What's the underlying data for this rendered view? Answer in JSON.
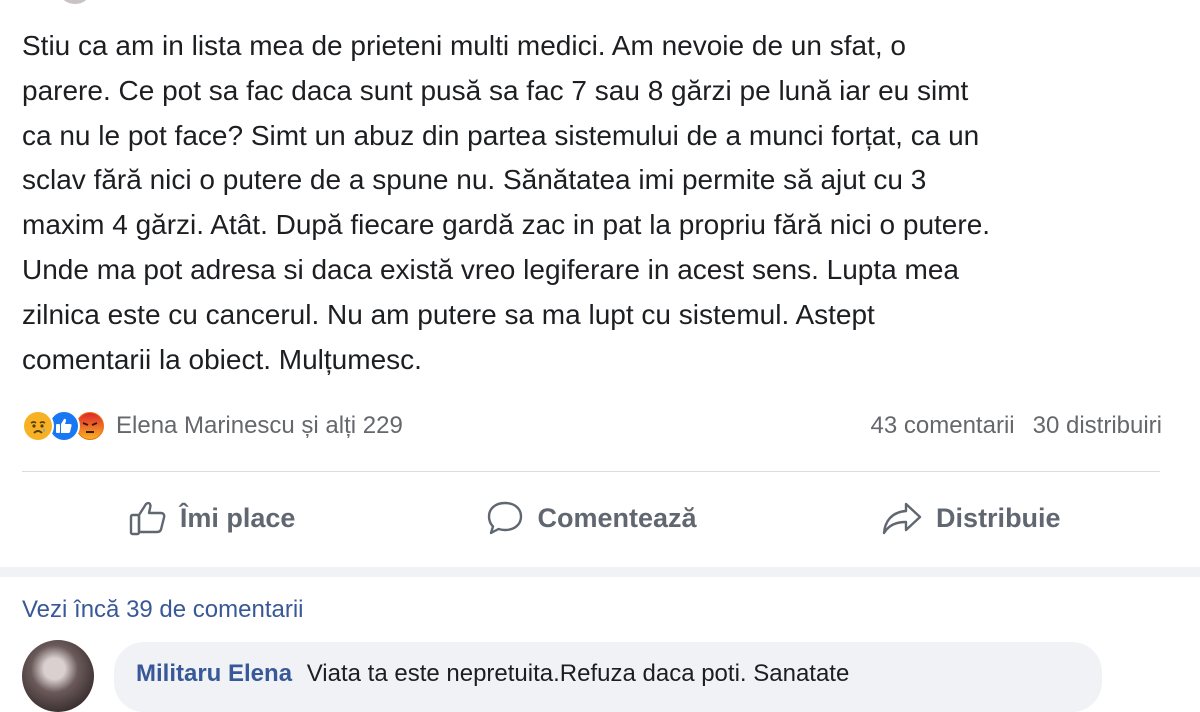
{
  "post": {
    "lines": [
      "Stiu ca am in lista mea de prieteni multi medici. Am nevoie de un sfat, o",
      "parere. Ce pot sa fac daca sunt pusă sa fac 7 sau 8 gărzi pe lună iar eu simt",
      "ca nu le pot face? Simt un abuz din partea sistemului de a munci forțat, ca un",
      "sclav fără nici o putere de a spune nu. Sănătatea imi permite să ajut cu 3",
      "maxim 4 gărzi. Atât. După fiecare gardă zac in pat la propriu fără nici o putere.",
      "Unde ma pot adresa si daca există vreo legiferare in acest sens. Lupta mea",
      "zilnica este cu cancerul. Nu am putere sa ma lupt cu sistemul. Astept",
      "comentarii la obiect. Mulțumesc."
    ]
  },
  "reactions": {
    "icons": [
      "sad-reaction-icon",
      "like-reaction-icon",
      "angry-reaction-icon"
    ],
    "colors": {
      "sad": "#f7b125",
      "like": "#1877f2",
      "angry": "#e9710f"
    },
    "reactors": "Elena Marinescu și alți 229",
    "comments_count": "43 comentarii",
    "shares_count": "30 distribuiri"
  },
  "actions": {
    "like_label": "Îmi place",
    "comment_label": "Comentează",
    "share_label": "Distribuie"
  },
  "comments": {
    "more_label": "Vezi încă 39 de comentarii",
    "first": {
      "author": "Militaru Elena",
      "text": "Viata ta este nepretuita.Refuza daca poti. Sanatate"
    }
  }
}
